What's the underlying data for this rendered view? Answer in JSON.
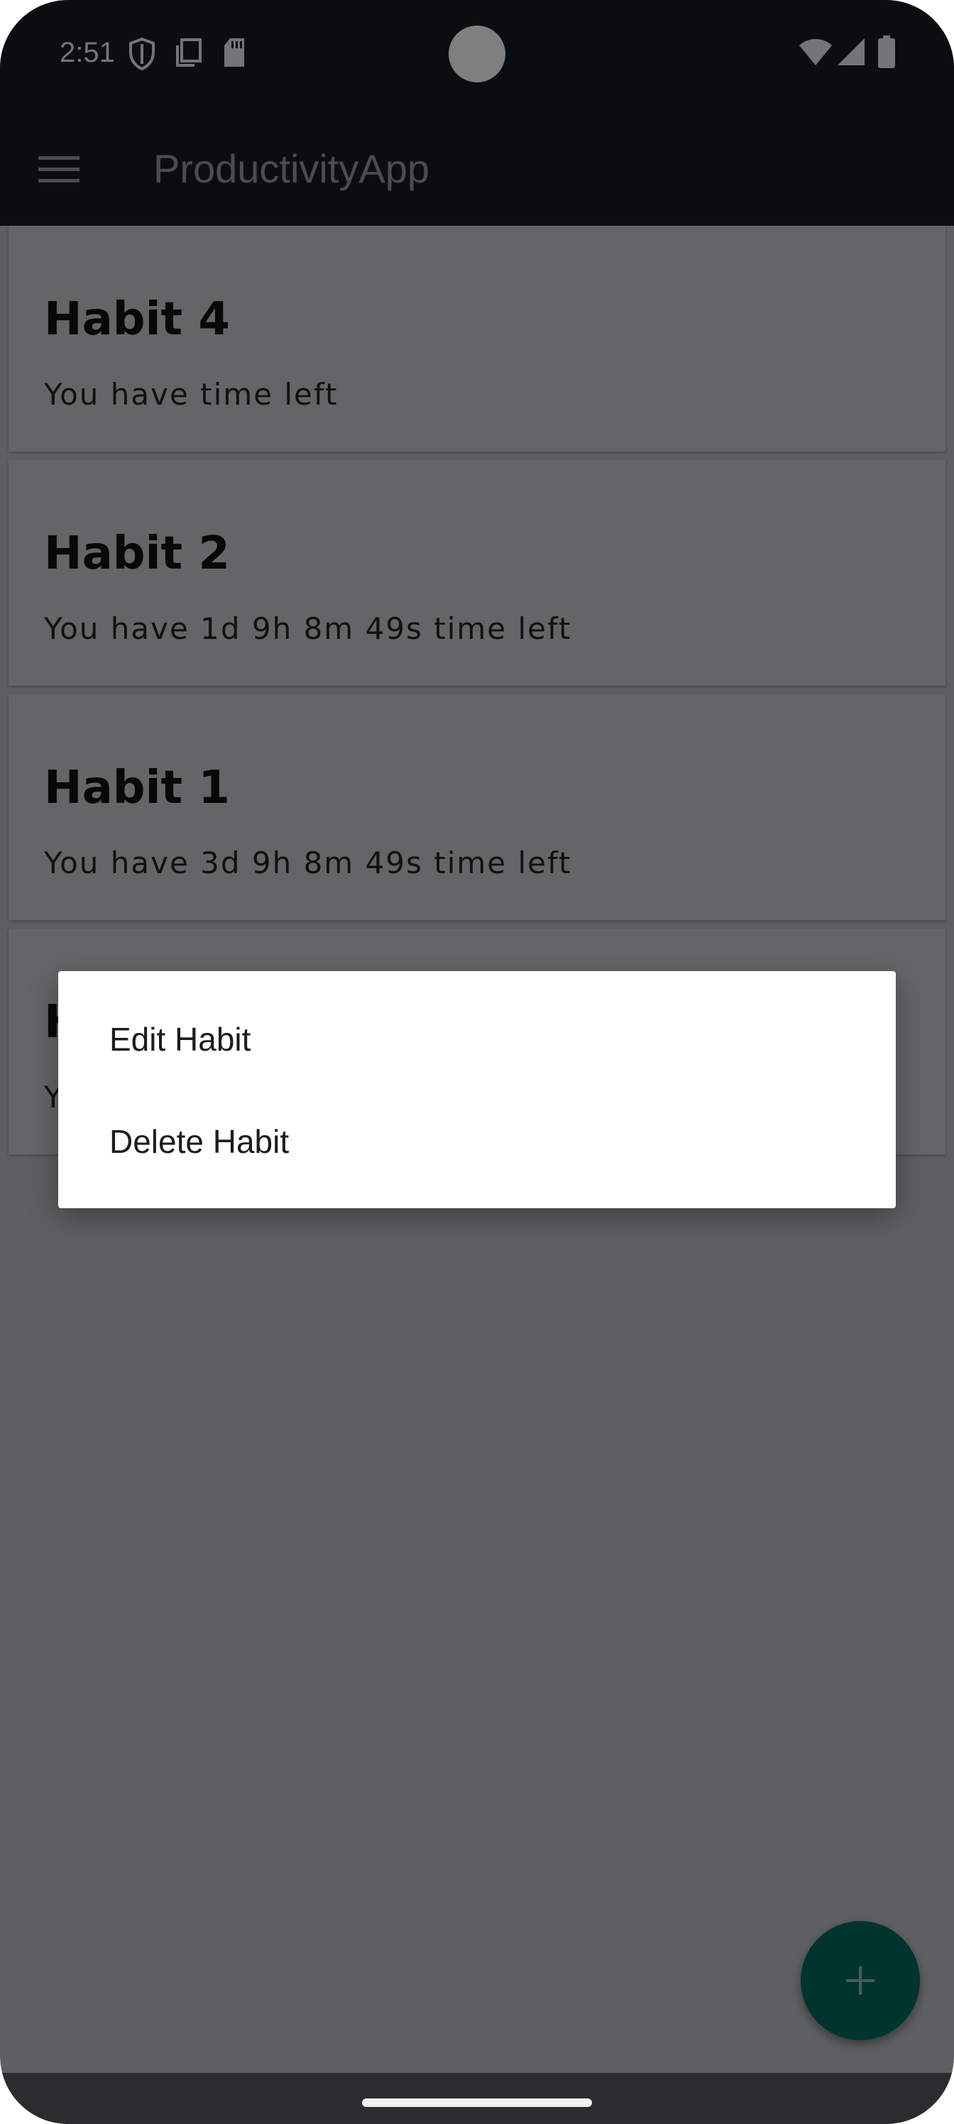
{
  "status_bar": {
    "time": "2:51",
    "icons": [
      "shield-icon",
      "copy-icon",
      "sd-card-icon",
      "wifi-icon",
      "signal-icon",
      "battery-icon"
    ]
  },
  "app_bar": {
    "menu_icon": "hamburger-menu-icon",
    "title": "ProductivityApp"
  },
  "habits": [
    {
      "title": "Habit 4",
      "subtitle": "You have  time left"
    },
    {
      "title": "Habit 2",
      "subtitle": "You have 1d 9h 8m 49s time left"
    },
    {
      "title": "Habit 1",
      "subtitle": "You have 3d 9h 8m 49s time left"
    },
    {
      "title": "H",
      "subtitle": "Y"
    }
  ],
  "dialog": {
    "items": [
      {
        "label": "Edit Habit"
      },
      {
        "label": "Delete Habit"
      }
    ]
  },
  "fab": {
    "icon": "plus-icon"
  },
  "colors": {
    "app_bar": "#171d23",
    "fab": "#00695c",
    "scrim": "rgba(0,0,0,0.5)"
  }
}
